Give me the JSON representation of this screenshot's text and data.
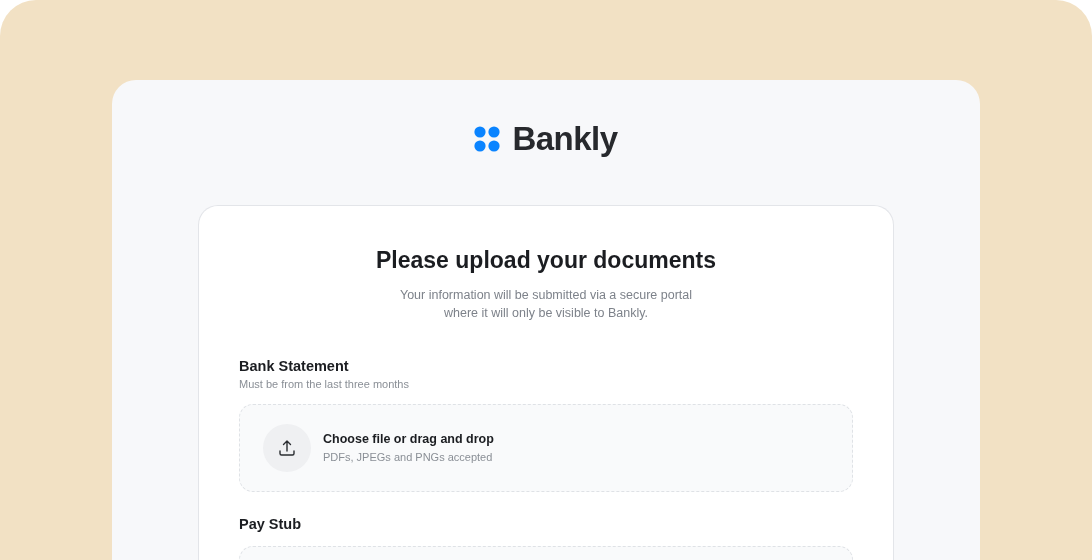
{
  "brand": {
    "name": "Bankly"
  },
  "heading": "Please upload your documents",
  "subtitle_lines": [
    "Your information will be submitted via a secure portal",
    "where it will only be visible to Bankly."
  ],
  "sections": [
    {
      "kind": "upload",
      "title": "Bank Statement",
      "description": "Must be from the last three months",
      "dropzone_title": "Choose file or drag and drop",
      "dropzone_hint": "PDFs, JPEGs and PNGs accepted"
    },
    {
      "kind": "upload",
      "title": "Pay Stub"
    }
  ]
}
